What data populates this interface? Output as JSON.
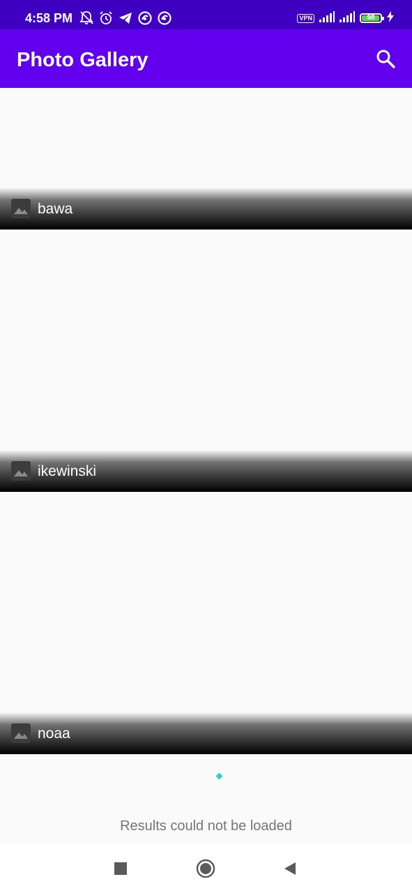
{
  "status_bar": {
    "time": "4:58 PM",
    "left_icons": [
      "bell-off-icon",
      "alarm-icon",
      "telegram-icon",
      "app-icon",
      "app-icon"
    ],
    "vpn_label": "VPN",
    "battery_level": "98",
    "battery_fraction": 0.98
  },
  "app_bar": {
    "title": "Photo Gallery",
    "search_icon": "search-icon"
  },
  "photos": [
    {
      "caption": "bawa",
      "icon": "image-icon"
    },
    {
      "caption": "ikewinski",
      "icon": "image-icon"
    },
    {
      "caption": "noaa",
      "icon": "image-icon"
    }
  ],
  "footer": {
    "error_message": "Results could not be loaded"
  },
  "nav_bar": {
    "buttons": [
      "recents-square-icon",
      "home-circle-icon",
      "back-triangle-icon"
    ]
  },
  "colors": {
    "status_bar": "#3f00c2",
    "app_bar": "#6200ee",
    "background": "#fafafa",
    "loading_dot": "#2fd1c1",
    "battery_fill": "#5ed54b"
  }
}
